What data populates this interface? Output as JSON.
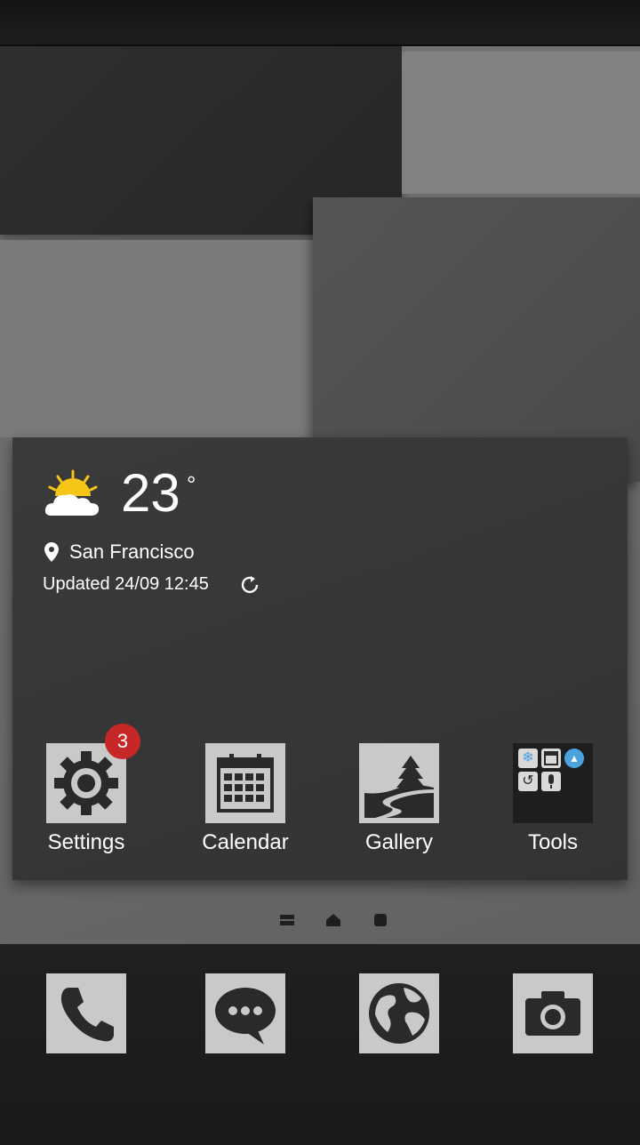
{
  "weather": {
    "temperature": "23",
    "degree_symbol": "°",
    "location": "San Francisco",
    "updated": "Updated 24/09 12:45",
    "icon": "partly-sunny-icon"
  },
  "apps": [
    {
      "label": "Settings",
      "icon": "gear-icon",
      "badge": "3"
    },
    {
      "label": "Calendar",
      "icon": "calendar-icon"
    },
    {
      "label": "Gallery",
      "icon": "landscape-icon"
    },
    {
      "label": "Tools",
      "icon": "folder-icon"
    }
  ],
  "pager": [
    "menu-icon",
    "home-icon",
    "page-dot-icon"
  ],
  "dock": [
    {
      "icon": "phone-icon"
    },
    {
      "icon": "messages-icon"
    },
    {
      "icon": "globe-icon"
    },
    {
      "icon": "camera-icon"
    }
  ],
  "colors": {
    "badge": "#c62828",
    "sun": "#f5c518",
    "tile": "#c9c9c9",
    "widget_bg": "#363636"
  }
}
